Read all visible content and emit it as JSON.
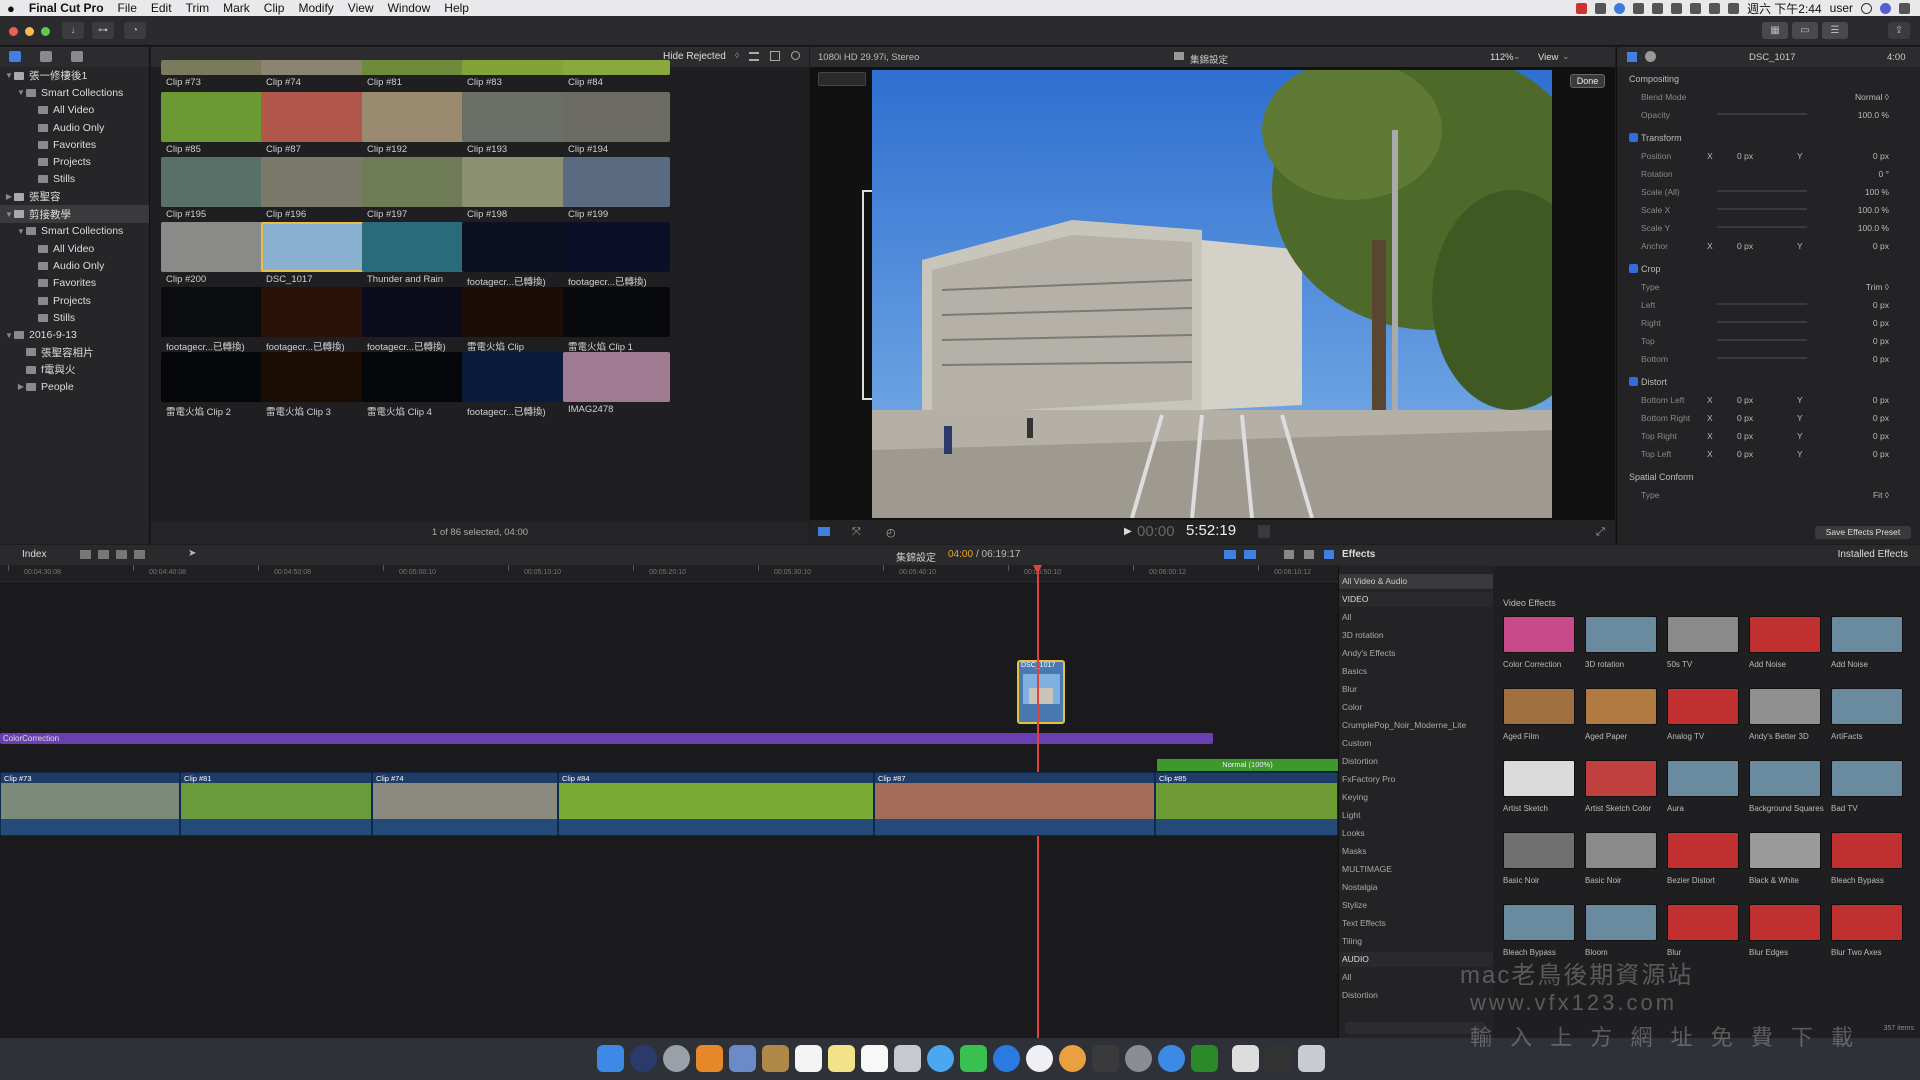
{
  "menubar": {
    "apple": "",
    "app": "Final Cut Pro",
    "items": [
      "File",
      "Edit",
      "Trim",
      "Mark",
      "Clip",
      "Modify",
      "View",
      "Window",
      "Help"
    ],
    "clock": "週六 下午2:44",
    "user": "user"
  },
  "library": {
    "rows": [
      {
        "label": "張一修棲後1",
        "indent": 0,
        "type": "library",
        "open": true
      },
      {
        "label": "Smart Collections",
        "indent": 1,
        "type": "folder",
        "open": true
      },
      {
        "label": "All Video",
        "indent": 2,
        "type": "smart"
      },
      {
        "label": "Audio Only",
        "indent": 2,
        "type": "smart"
      },
      {
        "label": "Favorites",
        "indent": 2,
        "type": "smart"
      },
      {
        "label": "Projects",
        "indent": 2,
        "type": "smart"
      },
      {
        "label": "Stills",
        "indent": 2,
        "type": "smart"
      },
      {
        "label": "張聖容",
        "indent": 0,
        "type": "library",
        "open": false
      },
      {
        "label": "剪接教學",
        "indent": 0,
        "type": "library",
        "open": true,
        "selected": true
      },
      {
        "label": "Smart Collections",
        "indent": 1,
        "type": "folder",
        "open": true
      },
      {
        "label": "All Video",
        "indent": 2,
        "type": "smart"
      },
      {
        "label": "Audio Only",
        "indent": 2,
        "type": "smart"
      },
      {
        "label": "Favorites",
        "indent": 2,
        "type": "smart"
      },
      {
        "label": "Projects",
        "indent": 2,
        "type": "smart"
      },
      {
        "label": "Stills",
        "indent": 2,
        "type": "smart"
      },
      {
        "label": "2016-9-13",
        "indent": 0,
        "type": "event",
        "open": true
      },
      {
        "label": "張聖容相片",
        "indent": 1,
        "type": "keyword"
      },
      {
        "label": "f電與火",
        "indent": 1,
        "type": "keyword"
      },
      {
        "label": "People",
        "indent": 1,
        "type": "folder",
        "open": false
      }
    ]
  },
  "browser": {
    "hide_rejected": "Hide Rejected",
    "status": "1 of 86 selected, 04:00",
    "clips": [
      {
        "label": "Clip #73",
        "color": "#7c7a5c"
      },
      {
        "label": "Clip #74",
        "color": "#8a8470"
      },
      {
        "label": "Clip #81",
        "color": "#6e8a3a"
      },
      {
        "label": "Clip #83",
        "color": "#82a23a"
      },
      {
        "label": "Clip #84",
        "color": "#8aa93c"
      },
      {
        "label": "Clip #85",
        "color": "#6b9a32"
      },
      {
        "label": "Clip #87",
        "color": "#b0564a"
      },
      {
        "label": "Clip #192",
        "color": "#9a8a70"
      },
      {
        "label": "Clip #193",
        "color": "#6a7068"
      },
      {
        "label": "Clip #194",
        "color": "#6c6c64"
      },
      {
        "label": "Clip #195",
        "color": "#587068"
      },
      {
        "label": "Clip #196",
        "color": "#7a7a6a"
      },
      {
        "label": "Clip #197",
        "color": "#6f7a56"
      },
      {
        "label": "Clip #198",
        "color": "#8a9070"
      },
      {
        "label": "Clip #199",
        "color": "#5a6a80"
      },
      {
        "label": "Clip #200",
        "color": "#8a8a88"
      },
      {
        "label": "DSC_1017",
        "color": "#8ab0d0"
      },
      {
        "label": "Thunder and Rain",
        "color": "#2a6a7a"
      },
      {
        "label": "footagecr...已轉換)",
        "color": "#0c1020"
      },
      {
        "label": "footagecr...已轉換)",
        "color": "#0c0f28"
      },
      {
        "label": "footagecr...已轉換)",
        "color": "#0a0c10"
      },
      {
        "label": "footagecr...已轉換)",
        "color": "#2a1208"
      },
      {
        "label": "footagecr...已轉換)",
        "color": "#0a0c1c"
      },
      {
        "label": "雷電火焰 Clip",
        "color": "#1a0e06"
      },
      {
        "label": "雷電火焰 Clip 1",
        "color": "#08090c"
      },
      {
        "label": "雷電火焰 Clip 2",
        "color": "#06070a"
      },
      {
        "label": "雷電火焰 Clip 3",
        "color": "#1c0d04"
      },
      {
        "label": "雷電火焰 Clip 4",
        "color": "#06070a"
      },
      {
        "label": "footagecr...已轉換)",
        "color": "#0a1a3a"
      },
      {
        "label": "IMAG2478",
        "color": "#a07a90"
      }
    ]
  },
  "viewer": {
    "format": "1080i HD 29.97i, Stereo",
    "project": "集錦設定",
    "zoom": "112%",
    "view": "View",
    "done": "Done",
    "timecode": "5:52:19",
    "timecode_prefix": "00:00"
  },
  "inspector": {
    "clip_name": "DSC_1017",
    "duration": "4:00",
    "save_preset": "Save Effects Preset",
    "rows": [
      {
        "label": "Compositing",
        "section": true
      },
      {
        "label": "Blend Mode",
        "value": "Normal ◊"
      },
      {
        "label": "Opacity",
        "value": "100.0 %",
        "slider": true
      },
      {
        "label": "Transform",
        "section": true,
        "check": true
      },
      {
        "label": "Position",
        "xy": [
          "0 px",
          "0 px"
        ]
      },
      {
        "label": "Rotation",
        "value": "0 °"
      },
      {
        "label": "Scale (All)",
        "value": "100 %",
        "slider": true
      },
      {
        "label": "Scale X",
        "value": "100.0 %",
        "slider": true
      },
      {
        "label": "Scale Y",
        "value": "100.0 %",
        "slider": true
      },
      {
        "label": "Anchor",
        "xy": [
          "0 px",
          "0 px"
        ]
      },
      {
        "label": "Crop",
        "section": true,
        "check": true
      },
      {
        "label": "Type",
        "value": "Trim ◊"
      },
      {
        "label": "Left",
        "value": "0 px",
        "slider": true
      },
      {
        "label": "Right",
        "value": "0 px",
        "slider": true
      },
      {
        "label": "Top",
        "value": "0 px",
        "slider": true
      },
      {
        "label": "Bottom",
        "value": "0 px",
        "slider": true
      },
      {
        "label": "Distort",
        "section": true,
        "check": true
      },
      {
        "label": "Bottom Left",
        "xy": [
          "0 px",
          "0 px"
        ]
      },
      {
        "label": "Bottom Right",
        "xy": [
          "0 px",
          "0 px"
        ]
      },
      {
        "label": "Top Right",
        "xy": [
          "0 px",
          "0 px"
        ]
      },
      {
        "label": "Top Left",
        "xy": [
          "0 px",
          "0 px"
        ]
      },
      {
        "label": "Spatial Conform",
        "section": true
      },
      {
        "label": "Type",
        "value": "Fit ◊"
      }
    ]
  },
  "timeline": {
    "index": "Index",
    "project": "集錦設定",
    "position": "04:00",
    "total": "/ 06:19:17",
    "ruler": [
      "00:04:30:08",
      "00:04:40:08",
      "00:04:50:08",
      "00:05:00:10",
      "00:05:10:10",
      "00:05:20:10",
      "00:05:30:10",
      "00:05:40:10",
      "00:05:50:10",
      "00:06:00:12",
      "00:06:10:12"
    ],
    "adjustment": "ColorCorrection",
    "connected": "DSC_1017",
    "normal": "Normal (100%)",
    "clips": [
      {
        "label": "Clip #73",
        "color": "#7b8a7a"
      },
      {
        "label": "Clip #81",
        "color": "#6a9a3a"
      },
      {
        "label": "Clip #74",
        "color": "#8a8a80"
      },
      {
        "label": "Clip #84",
        "color": "#7aaa36"
      },
      {
        "label": "Clip #87",
        "color": "#a46a5a"
      },
      {
        "label": "Clip #85",
        "color": "#6e9a34"
      }
    ]
  },
  "effects": {
    "title": "Effects",
    "installed": "Installed Effects",
    "section_title": "Video Effects",
    "count": "357 items",
    "categories": [
      {
        "label": "All Video & Audio",
        "selected": true
      },
      {
        "label": "VIDEO",
        "header": true
      },
      {
        "label": "All"
      },
      {
        "label": "3D rotation"
      },
      {
        "label": "Andy's Effects"
      },
      {
        "label": "Basics"
      },
      {
        "label": "Blur"
      },
      {
        "label": "Color"
      },
      {
        "label": "CrumplePop_Noir_Moderne_Lite"
      },
      {
        "label": "Custom"
      },
      {
        "label": "Distortion"
      },
      {
        "label": "FxFactory Pro"
      },
      {
        "label": "Keying"
      },
      {
        "label": "Light"
      },
      {
        "label": "Looks"
      },
      {
        "label": "Masks"
      },
      {
        "label": "MULTIMAGE"
      },
      {
        "label": "Nostalgia"
      },
      {
        "label": "Stylize"
      },
      {
        "label": "Text Effects"
      },
      {
        "label": "Tiling"
      },
      {
        "label": "AUDIO",
        "header": true
      },
      {
        "label": "All"
      },
      {
        "label": "Distortion"
      }
    ],
    "items": [
      {
        "label": "Color Correction",
        "color": "#c84a8a"
      },
      {
        "label": "3D rotation",
        "color": "#6a8aa0"
      },
      {
        "label": "50s TV",
        "color": "#8a8a8a"
      },
      {
        "label": "Add Noise",
        "color": "#c03030"
      },
      {
        "label": "Add Noise",
        "color": "#6a8aa0"
      },
      {
        "label": "Aged Film",
        "color": "#a07040"
      },
      {
        "label": "Aged Paper",
        "color": "#b07a40"
      },
      {
        "label": "Analog TV",
        "color": "#c03030"
      },
      {
        "label": "Andy's Better 3D",
        "color": "#909090"
      },
      {
        "label": "ArtiFacts",
        "color": "#6a8aa0"
      },
      {
        "label": "Artist Sketch",
        "color": "#dadada"
      },
      {
        "label": "Artist Sketch Color",
        "color": "#c04040"
      },
      {
        "label": "Aura",
        "color": "#6a8aa0"
      },
      {
        "label": "Background Squares",
        "color": "#6a8aa0"
      },
      {
        "label": "Bad TV",
        "color": "#6a8aa0"
      },
      {
        "label": "Basic Noir",
        "color": "#707070"
      },
      {
        "label": "Basic Noir",
        "color": "#8a8a8a"
      },
      {
        "label": "Bezier Distort",
        "color": "#c03030"
      },
      {
        "label": "Black & White",
        "color": "#9a9a9a"
      },
      {
        "label": "Bleach Bypass",
        "color": "#c03030"
      },
      {
        "label": "Bleach Bypass",
        "color": "#6a8aa0"
      },
      {
        "label": "Bloom",
        "color": "#6a8aa0"
      },
      {
        "label": "Blur",
        "color": "#c03030"
      },
      {
        "label": "Blur Edges",
        "color": "#c03030"
      },
      {
        "label": "Blur Two Axes",
        "color": "#c03030"
      }
    ]
  },
  "watermark": {
    "line1": "mac老鳥後期資源站",
    "line2": "www.vfx123.com",
    "line3": "輸 入 上 方 網 址   免 費 下 載"
  },
  "colors": {
    "accent": "#2f6fdc",
    "playhead": "#e04040",
    "adjustment": "#6a3fb0",
    "selection": "#e6c040"
  }
}
